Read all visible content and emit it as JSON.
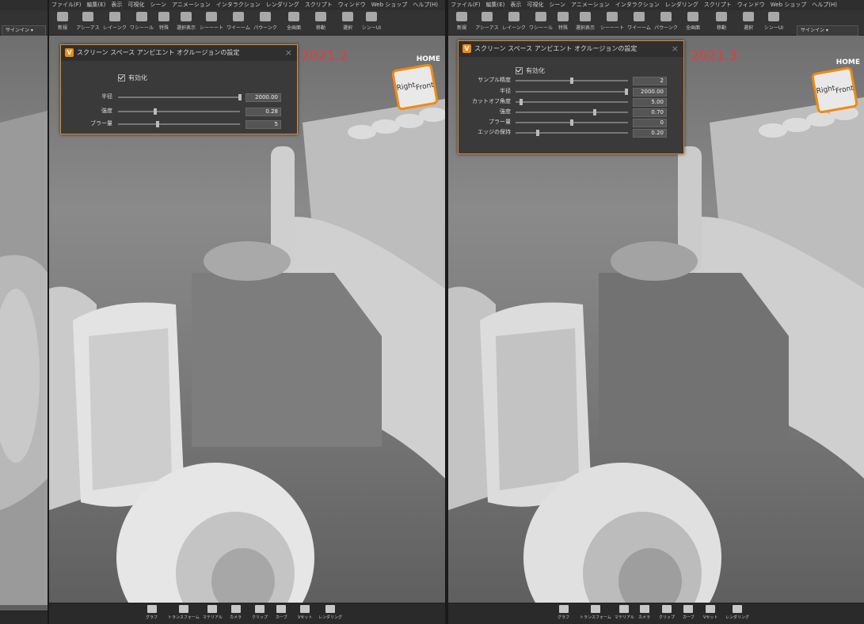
{
  "menu": [
    "ファイル(F)",
    "編集(E)",
    "表示",
    "可視化",
    "シーン",
    "アニメーション",
    "インタラクション",
    "レンダリング",
    "スクリプト",
    "ウィンドウ",
    "Web ショップ",
    "ヘルプ(H)"
  ],
  "toolbar": [
    "新規",
    "アシーアス",
    "レイーンク",
    "ワシーール",
    "特殊",
    "選択表示",
    "シーーート",
    "ワイーーム",
    "パウーンク",
    "全画面",
    "移動",
    "選択",
    "シンーUI"
  ],
  "signin": "サインイン",
  "signin_left": "サインイン",
  "bottom": [
    "グラフ",
    "トランスフォーム",
    "マテリアル",
    "カメラ",
    "クリップ",
    "カーブ",
    "Vセット",
    "レンダリング"
  ],
  "navcube": {
    "home": "HOME",
    "front": "Front",
    "right": "Right"
  },
  "colors": {
    "accent": "#f08a12",
    "version": "#e53b3b"
  },
  "dialog_old": {
    "version": "2021.2",
    "title": "スクリーン スペース アンビエント オクルージョンの設定",
    "enabled_label": "有効化",
    "rows": [
      {
        "label": "半径",
        "value": "2000.00"
      },
      {
        "label": "強度",
        "value": "0.28"
      },
      {
        "label": "ブラー量",
        "value": "5"
      }
    ]
  },
  "dialog_new": {
    "version": "2021.3",
    "title": "スクリーン スペース アンビエント オクルージョンの設定",
    "enabled_label": "有効化",
    "rows": [
      {
        "label": "サンプル精度",
        "value": "2"
      },
      {
        "label": "半径",
        "value": "2000.00"
      },
      {
        "label": "カットオフ角度",
        "value": "5.00"
      },
      {
        "label": "強度",
        "value": "0.70"
      },
      {
        "label": "ブラー量",
        "value": "0"
      },
      {
        "label": "エッジの保持",
        "value": "0.20"
      }
    ]
  }
}
